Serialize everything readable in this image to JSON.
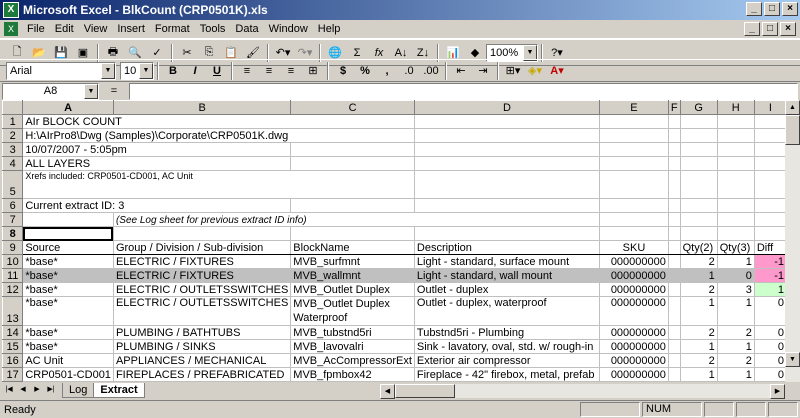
{
  "window": {
    "title": "Microsoft Excel - BlkCount (CRP0501K).xls"
  },
  "menus": [
    "File",
    "Edit",
    "View",
    "Insert",
    "Format",
    "Tools",
    "Data",
    "Window",
    "Help"
  ],
  "toolbar": {
    "zoom": "100%",
    "font_name": "Arial",
    "font_size": "10"
  },
  "formula_bar": {
    "name_box": "A8",
    "fx": "=",
    "value": ""
  },
  "columns": [
    "A",
    "B",
    "C",
    "D",
    "E",
    "F",
    "G",
    "H",
    "I"
  ],
  "rows": [
    {
      "num": "1",
      "a": "AIr BLOCK COUNT",
      "b": "",
      "c": "",
      "d": "",
      "e": "",
      "g": "",
      "h": "",
      "i": ""
    },
    {
      "num": "2",
      "a": "H:\\AIrPro8\\Dwg (Samples)\\Corporate\\CRP0501K.dwg",
      "b": "",
      "c": "",
      "d": "",
      "e": "",
      "g": "",
      "h": "",
      "i": ""
    },
    {
      "num": "3",
      "a": "10/07/2007 - 5:05pm",
      "b": "",
      "c": "",
      "d": "",
      "e": "",
      "g": "",
      "h": "",
      "i": ""
    },
    {
      "num": "4",
      "a": "ALL LAYERS",
      "b": "",
      "c": "",
      "d": "",
      "e": "",
      "g": "",
      "h": "",
      "i": ""
    },
    {
      "num": "5",
      "a": "Xrefs included: CRP0501-CD001, AC Unit",
      "b": "",
      "c": "",
      "d": "",
      "e": "",
      "g": "",
      "h": "",
      "i": ""
    },
    {
      "num": "6",
      "a": "Current extract ID: 3",
      "b": "",
      "c": "",
      "d": "",
      "e": "",
      "g": "",
      "h": "",
      "i": ""
    },
    {
      "num": "7",
      "a": "",
      "b": "(See Log sheet for previous extract ID info)",
      "c": "",
      "d": "",
      "e": "",
      "g": "",
      "h": "",
      "i": ""
    },
    {
      "num": "8",
      "a": "",
      "b": "",
      "c": "",
      "d": "",
      "e": "",
      "g": "",
      "h": "",
      "i": ""
    },
    {
      "num": "9",
      "a": "Source",
      "b": "Group / Division / Sub-division",
      "c": "BlockName",
      "d": "Description",
      "e": "SKU",
      "g": "Qty(2)",
      "h": "Qty(3)",
      "i": "Diff"
    },
    {
      "num": "10",
      "a": "*base*",
      "b": "ELECTRIC / FIXTURES",
      "c": "MVB_surfmnt",
      "d": "Light - standard, surface mount",
      "e": "000000000",
      "g": "2",
      "h": "1",
      "i": "-1"
    },
    {
      "num": "11",
      "a": "*base*",
      "b": "ELECTRIC / FIXTURES",
      "c": "MVB_wallmnt",
      "d": "Light - standard, wall mount",
      "e": "000000000",
      "g": "1",
      "h": "0",
      "i": "-1"
    },
    {
      "num": "12",
      "a": "*base*",
      "b": "ELECTRIC / OUTLETSSWITCHES",
      "c": "MVB_Outlet Duplex",
      "d": "Outlet - duplex",
      "e": "000000000",
      "g": "2",
      "h": "3",
      "i": "1"
    },
    {
      "num": "13",
      "a": "*base*",
      "b": "ELECTRIC / OUTLETSSWITCHES",
      "c": "MVB_Outlet Duplex",
      "c2": "Waterproof",
      "d": "Outlet - duplex, waterproof",
      "e": "000000000",
      "g": "1",
      "h": "1",
      "i": "0"
    },
    {
      "num": "14",
      "a": "*base*",
      "b": "PLUMBING / BATHTUBS",
      "c": "MVB_tubstnd5ri",
      "d": "Tubstnd5ri - Plumbing",
      "e": "000000000",
      "g": "2",
      "h": "2",
      "i": "0"
    },
    {
      "num": "15",
      "a": "*base*",
      "b": "PLUMBING / SINKS",
      "c": "MVB_lavovalri",
      "d": "Sink - lavatory, oval, std. w/ rough-in",
      "e": "000000000",
      "g": "1",
      "h": "1",
      "i": "0"
    },
    {
      "num": "16",
      "a": "AC Unit",
      "b": "APPLIANCES / MECHANICAL",
      "c": "MVB_AcCompressorExt",
      "d": "Exterior air compressor",
      "e": "000000000",
      "g": "2",
      "h": "2",
      "i": "0"
    },
    {
      "num": "17",
      "a": "CRP0501-CD001",
      "b": "FIREPLACES / PREFABRICATED",
      "c": "MVB_fpmbox42",
      "d": "Fireplace - 42\" firebox, metal, prefab",
      "e": "000000000",
      "g": "1",
      "h": "1",
      "i": "0"
    }
  ],
  "sheets": [
    "Log",
    "Extract"
  ],
  "status": {
    "text": "Ready",
    "num": "NUM"
  },
  "colors": {
    "title_blue": "#0a246a",
    "diff_negative": "#ff99cc",
    "diff_positive": "#ccffcc",
    "highlight_row": "#c0c0c0"
  }
}
